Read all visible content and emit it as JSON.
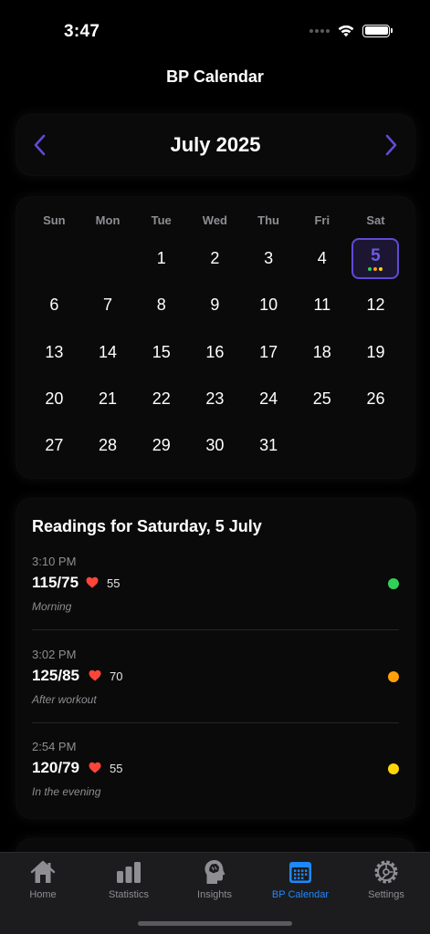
{
  "status_bar": {
    "time": "3:47"
  },
  "nav": {
    "title": "BP Calendar"
  },
  "month_nav": {
    "label": "July 2025",
    "accent": "#5e4bd6"
  },
  "calendar": {
    "weekdays": [
      "Sun",
      "Mon",
      "Tue",
      "Wed",
      "Thu",
      "Fri",
      "Sat"
    ],
    "leading_blanks": 2,
    "days": [
      "1",
      "2",
      "3",
      "4",
      "5",
      "6",
      "7",
      "8",
      "9",
      "10",
      "11",
      "12",
      "13",
      "14",
      "15",
      "16",
      "17",
      "18",
      "19",
      "20",
      "21",
      "22",
      "23",
      "24",
      "25",
      "26",
      "27",
      "28",
      "29",
      "30",
      "31"
    ],
    "selected_day": "5",
    "selected_dots": [
      "#30d158",
      "#ff9f0a",
      "#ffd60a"
    ]
  },
  "readings": {
    "title": "Readings for Saturday, 5 July",
    "items": [
      {
        "time": "3:10 PM",
        "bp": "115/75",
        "pulse": "55",
        "note": "Morning",
        "status_color": "#30d158"
      },
      {
        "time": "3:02 PM",
        "bp": "125/85",
        "pulse": "70",
        "note": "After workout",
        "status_color": "#ff9f0a"
      },
      {
        "time": "2:54 PM",
        "bp": "120/79",
        "pulse": "55",
        "note": "In the evening",
        "status_color": "#ffd60a"
      }
    ]
  },
  "tabs": [
    {
      "label": "Home",
      "icon": "house-icon"
    },
    {
      "label": "Statistics",
      "icon": "bar-chart-icon"
    },
    {
      "label": "Insights",
      "icon": "brain-head-icon"
    },
    {
      "label": "BP Calendar",
      "icon": "calendar-icon",
      "active": true
    },
    {
      "label": "Settings",
      "icon": "gear-icon"
    }
  ],
  "colors": {
    "active_tab": "#1e88ff",
    "heart": "#ff453a"
  }
}
